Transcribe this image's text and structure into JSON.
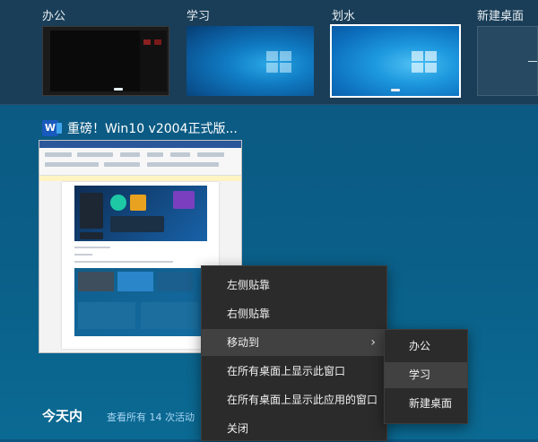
{
  "desktops": [
    {
      "label": "办公",
      "selected": false
    },
    {
      "label": "学习",
      "selected": false
    },
    {
      "label": "划水",
      "selected": true
    },
    {
      "label": "新建桌面",
      "selected": false
    }
  ],
  "window": {
    "app_icon": "word-icon",
    "app_icon_letter": "W",
    "title": "重磅！Win10 v2004正式版..."
  },
  "timeline": {
    "heading": "今天内",
    "see_all": "查看所有 14 次活动"
  },
  "context_menu": {
    "items": [
      {
        "label": "左侧贴靠"
      },
      {
        "label": "右侧贴靠"
      },
      {
        "label": "移动到",
        "has_submenu": true,
        "chevron": "›"
      },
      {
        "label": "在所有桌面上显示此窗口"
      },
      {
        "label": "在所有桌面上显示此应用的窗口"
      },
      {
        "label": "关闭"
      }
    ]
  },
  "submenu": {
    "items": [
      {
        "label": "办公"
      },
      {
        "label": "学习",
        "highlighted": true
      },
      {
        "label": "新建桌面"
      }
    ]
  },
  "colors": {
    "accent": "#1a78c2",
    "menu_bg": "#2b2b2b",
    "menu_hover": "#414141",
    "word_blue": "#185abd"
  }
}
